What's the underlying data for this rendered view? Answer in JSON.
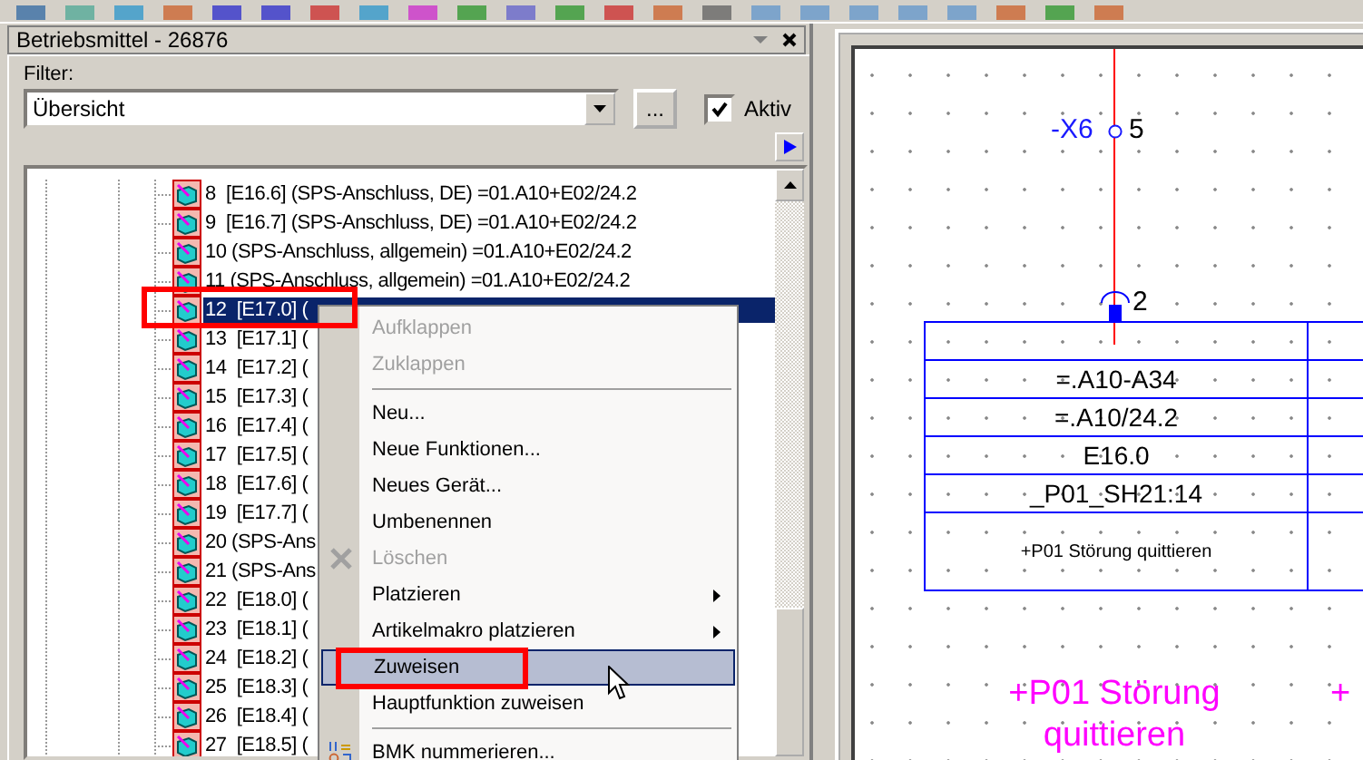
{
  "panel": {
    "title": "Betriebsmittel - 26876",
    "filter_label": "Filter:",
    "filter_value": "Übersicht",
    "browse_button": "...",
    "active": {
      "label": "Aktiv",
      "checked": true
    }
  },
  "tree": {
    "rows": [
      {
        "label": "8  [E16.6] (SPS-Anschluss, DE) =01.A10+E02/24.2",
        "selected": false
      },
      {
        "label": "9  [E16.7] (SPS-Anschluss, DE) =01.A10+E02/24.2",
        "selected": false
      },
      {
        "label": "10 (SPS-Anschluss, allgemein) =01.A10+E02/24.2",
        "selected": false
      },
      {
        "label": "11 (SPS-Anschluss, allgemein) =01.A10+E02/24.2",
        "selected": false
      },
      {
        "label": "12  [E17.0] (",
        "selected": true
      },
      {
        "label": "13  [E17.1] (",
        "selected": false
      },
      {
        "label": "14  [E17.2] (",
        "selected": false
      },
      {
        "label": "15  [E17.3] (",
        "selected": false
      },
      {
        "label": "16  [E17.4] (",
        "selected": false
      },
      {
        "label": "17  [E17.5] (",
        "selected": false
      },
      {
        "label": "18  [E17.6] (",
        "selected": false
      },
      {
        "label": "19  [E17.7] (",
        "selected": false
      },
      {
        "label": "20 (SPS-Ans",
        "selected": false
      },
      {
        "label": "21 (SPS-Ans",
        "selected": false
      },
      {
        "label": "22  [E18.0] (",
        "selected": false
      },
      {
        "label": "23  [E18.1] (",
        "selected": false
      },
      {
        "label": "24  [E18.2] (",
        "selected": false
      },
      {
        "label": "25  [E18.3] (",
        "selected": false
      },
      {
        "label": "26  [E18.4] (",
        "selected": false
      },
      {
        "label": "27  [E18.5] (",
        "selected": false
      }
    ]
  },
  "context_menu": {
    "items": [
      {
        "kind": "item",
        "label": "Aufklappen",
        "disabled": true,
        "selected": false
      },
      {
        "kind": "item",
        "label": "Zuklappen",
        "disabled": true,
        "selected": false
      },
      {
        "kind": "separator"
      },
      {
        "kind": "item",
        "label": "Neu...",
        "disabled": false,
        "selected": false
      },
      {
        "kind": "item",
        "label": "Neue Funktionen...",
        "disabled": false,
        "selected": false
      },
      {
        "kind": "item",
        "label": "Neues Gerät...",
        "disabled": false,
        "selected": false
      },
      {
        "kind": "item",
        "label": "Umbenennen",
        "disabled": false,
        "selected": false
      },
      {
        "kind": "delete",
        "label": "Löschen",
        "disabled": true,
        "selected": false
      },
      {
        "kind": "item",
        "label": "Platzieren",
        "disabled": false,
        "selected": false,
        "submenu": true
      },
      {
        "kind": "item",
        "label": "Artikelmakro platzieren",
        "disabled": false,
        "selected": false,
        "submenu": true
      },
      {
        "kind": "item",
        "label": "Zuweisen",
        "disabled": false,
        "selected": true
      },
      {
        "kind": "item",
        "label": "Hauptfunktion zuweisen",
        "disabled": false,
        "selected": false
      },
      {
        "kind": "separator"
      },
      {
        "kind": "numbering",
        "label": "BMK nummerieren...",
        "disabled": false,
        "selected": false
      }
    ]
  },
  "schematic": {
    "terminal": {
      "name": "-X6",
      "number": "5"
    },
    "pin": "2",
    "table_rows": [
      "",
      "=.A10-A34",
      "=.A10/24.2",
      "E16.0",
      "_P01_SH21:14"
    ],
    "comment": "+P01 Störung quittieren",
    "label_lines": [
      "+P01 Störung",
      "quittieren"
    ],
    "next_label": "+"
  }
}
